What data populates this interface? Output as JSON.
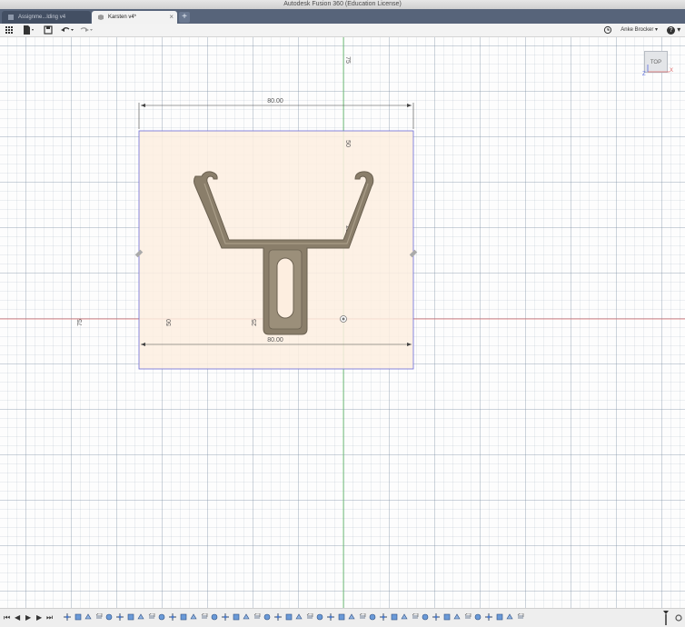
{
  "window": {
    "title": "Autodesk Fusion 360 (Education License)"
  },
  "tabs": [
    {
      "label": "Assignme...lding v4",
      "active": false
    },
    {
      "label": "Karsten v4*",
      "active": true
    }
  ],
  "toolbar": {
    "user_name": "Anke Brocker",
    "help_label": "?"
  },
  "viewcube": {
    "face_label": "TOP",
    "axis_x": "X",
    "axis_z": "Z"
  },
  "sketch": {
    "width_dimension_top": "80.00",
    "width_dimension_bottom": "80.00",
    "dim_50_a": "50",
    "dim_50_b": "50",
    "dim_25_a": "25",
    "dim_25_b": "25",
    "dim_75_a": "75",
    "dim_75_b": "75"
  },
  "colors": {
    "tabbar": "#57647a",
    "sketch_fill": "#fdeee0",
    "part": "#8a7e6a",
    "x_axis": "#e06a6a",
    "y_axis": "#6ac66a"
  },
  "timeline": {
    "feature_count": 44
  }
}
